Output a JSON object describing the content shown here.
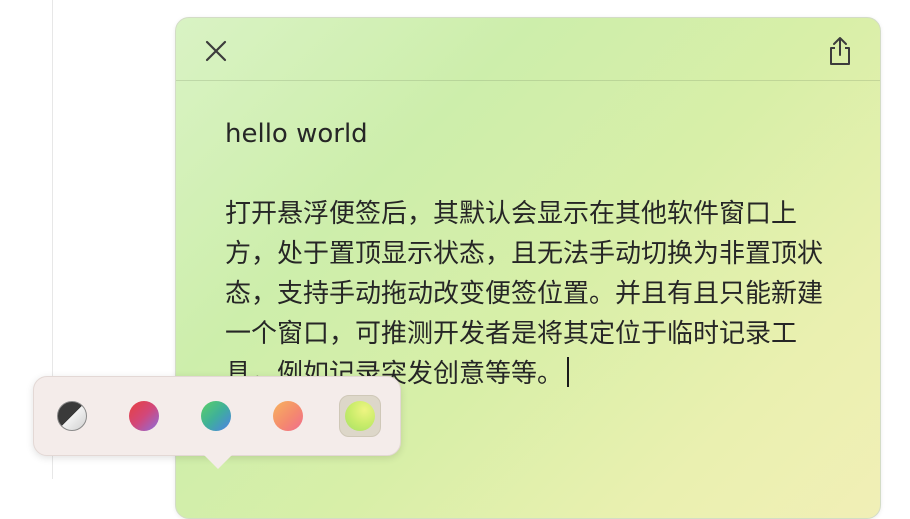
{
  "note": {
    "title": "hello world",
    "paragraph": "打开悬浮便签后，其默认会显示在其他软件窗口上方，处于置顶显示状态，且无法手动切换为非置顶状态，支持手动拖动改变便签位置。并且有且只能新建一个窗口，可推测开发者是将其定位于临时记录工具，例如记录突发创意等等。",
    "toolbar": {
      "close_icon": "close-icon",
      "share_icon": "share-icon"
    },
    "background_colors": [
      "#d9f3c4",
      "#cdeeab",
      "#eaf0b0",
      "#f1efb6"
    ]
  },
  "palette": {
    "swatches": [
      {
        "name": "auto-dark-light",
        "selected": false
      },
      {
        "name": "red-purple",
        "selected": false
      },
      {
        "name": "green-blue",
        "selected": false
      },
      {
        "name": "orange-pink",
        "selected": false
      },
      {
        "name": "yellow-green",
        "selected": true
      }
    ],
    "colors": [
      "#3a3a3a",
      "#e0455f",
      "#4fbf6a",
      "#f29a73",
      "#cfee6b"
    ]
  }
}
